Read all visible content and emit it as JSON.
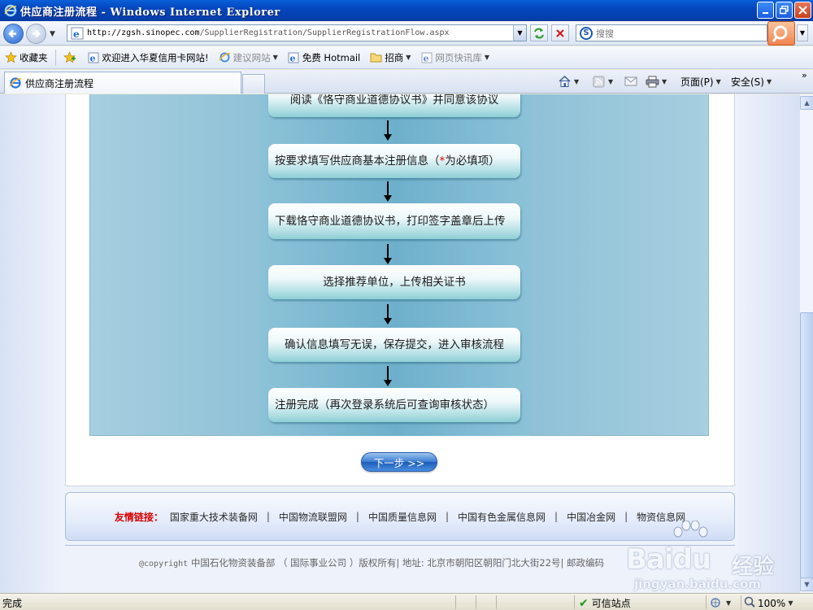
{
  "window": {
    "title": "供应商注册流程 - Windows Internet Explorer"
  },
  "address_bar": {
    "url_host": "http://zgsh.sinopec.com",
    "url_path": "/SupplierRegistration/SupplierRegistrationFlow.aspx"
  },
  "search": {
    "placeholder": "搜搜"
  },
  "favorites": {
    "favorites_label": "收藏夹",
    "items": [
      {
        "label": "欢迎进入华夏信用卡网站!",
        "icon": "ie-page-icon"
      },
      {
        "label": "建议网站",
        "icon": "ie-page-icon"
      },
      {
        "label": "免费 Hotmail",
        "icon": "ie-page-icon"
      },
      {
        "label": "招商",
        "icon": "folder-icon"
      },
      {
        "label": "网页快讯库",
        "icon": "ie-page-icon"
      }
    ]
  },
  "tabs": {
    "active": "供应商注册流程"
  },
  "command_bar": {
    "page_label": "页面(P)",
    "safety_label": "安全(S)"
  },
  "flow": {
    "steps": [
      "阅读《恪守商业道德协议书》并同意该协议",
      "按要求填写供应商基本注册信息（",
      "下载恪守商业道德协议书，打印签字盖章后上传",
      "选择推荐单位，上传相关证书",
      "确认信息填写无误，保存提交，进入审核流程",
      "注册完成（再次登录系统后可查询审核状态）"
    ],
    "step2_star": "*",
    "step2_suffix": "为必填项）",
    "next_button": "下一步 >>"
  },
  "friend_links": {
    "label": "友情链接：",
    "items": [
      "国家重大技术装备网",
      "中国物流联盟网",
      "中国质量信息网",
      "中国有色金属信息网",
      "中国冶金网",
      "物资信息网"
    ]
  },
  "footer": {
    "copyright_prefix": "@copyright",
    "copyright_text": "中国石化物资装备部 （ 国际事业公司 ）版权所有| 地址: 北京市朝阳区朝阳门北大街22号| 邮政编码"
  },
  "watermark": {
    "brand_bai": "Bai",
    "brand_du": "du",
    "brand_jingyan": "经验",
    "url": "jingyan.baidu.com"
  },
  "status_bar": {
    "status": "完成",
    "zone": "可信站点",
    "zoom": "100%"
  },
  "colors": {
    "titlebar": "#0446bd",
    "flow_bg": "#74b2cd",
    "friend_label": "#d80000",
    "required_star": "#e00000"
  }
}
